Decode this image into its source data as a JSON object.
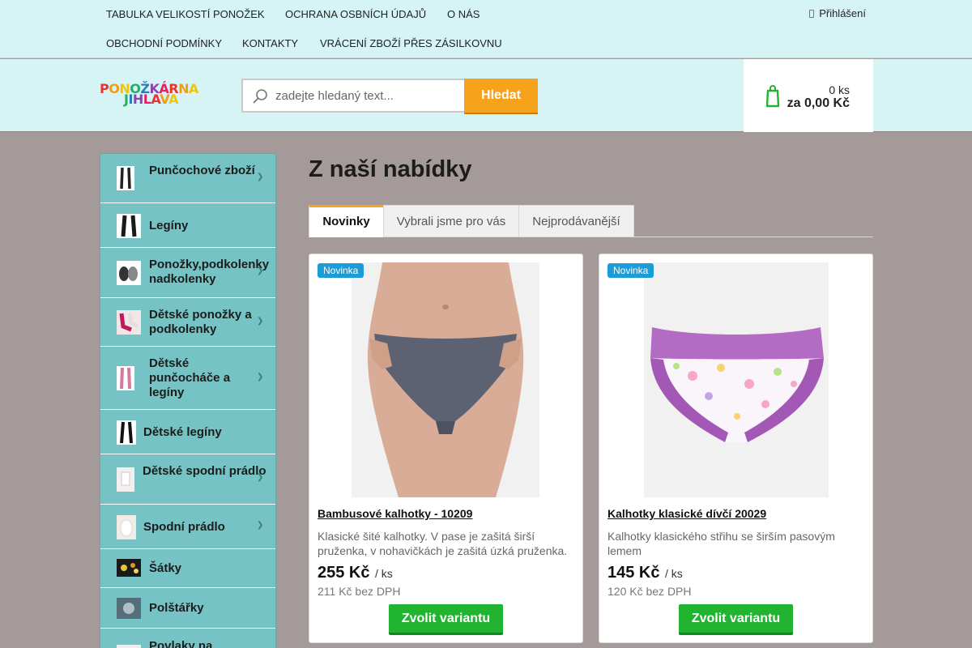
{
  "topnav": {
    "links": [
      "TABULKA VELIKOSTÍ PONOŽEK",
      "OCHRANA OSBNÍCH ÚDAJŮ",
      "O NÁS",
      "OBCHODNÍ PODMÍNKY",
      "KONTAKTY",
      "VRÁCENÍ ZBOŽÍ PŘES ZÁSILKOVNU"
    ],
    "login_label": "Přihlášení",
    "login_icon": "user-icon"
  },
  "header": {
    "logo_line1": "PONOŽKÁRNA",
    "logo_line2": "JIHLAVA",
    "logo_colors": [
      "#e4352f",
      "#f39c12",
      "#f1c40f",
      "#27ae60",
      "#2980b9",
      "#8e44ad",
      "#e91e63"
    ],
    "search": {
      "placeholder": "zadejte hledaný text...",
      "button": "Hledat",
      "icon": "search-icon"
    },
    "cart": {
      "qty": "0 ks",
      "total": "za 0,00 Kč",
      "icon": "shopping-bag-icon"
    }
  },
  "sidebar": {
    "items": [
      {
        "label": "Punčochové zboží",
        "has_sub": true
      },
      {
        "label": "Legíny",
        "has_sub": false
      },
      {
        "label": "Ponožky,podkolenky nadkolenky",
        "has_sub": true
      },
      {
        "label": "Dětské ponožky a podkolenky",
        "has_sub": true
      },
      {
        "label": "Dětské punčocháče a legíny",
        "has_sub": true
      },
      {
        "label": "Dětské legíny",
        "has_sub": false
      },
      {
        "label": "Dětské spodní prádlo",
        "has_sub": true
      },
      {
        "label": "Spodní prádlo",
        "has_sub": true
      },
      {
        "label": "Šátky",
        "has_sub": false
      },
      {
        "label": "Polštářky",
        "has_sub": false
      },
      {
        "label": "Povlaky na",
        "has_sub": false
      }
    ]
  },
  "main": {
    "title": "Z naší nabídky",
    "tabs": [
      {
        "label": "Novinky",
        "active": true
      },
      {
        "label": "Vybrali jsme pro vás",
        "active": false
      },
      {
        "label": "Nejprodávanější",
        "active": false
      }
    ],
    "products": [
      {
        "badge": "Novinka",
        "name": "Bambusové kalhotky - 10209",
        "description": "Klasické šité kalhotky. V pase je zašitá širší pruženka, v nohavičkách je zašitá úzká pruženka.",
        "price": "255 Kč",
        "unit": "/ ks",
        "price_no_vat": "211 Kč bez DPH",
        "button": "Zvolit variantu"
      },
      {
        "badge": "Novinka",
        "name": "Kalhotky klasické dívčí 20029",
        "description": "Kalhotky klasického střihu se širším pasovým lemem",
        "price": "145 Kč",
        "unit": "/ ks",
        "price_no_vat": "120 Kč bez DPH",
        "button": "Zvolit variantu"
      }
    ]
  },
  "colors": {
    "accent_orange": "#f7a21b",
    "header_bg": "#d6f3f6",
    "sidebar_bg": "#75c3c4",
    "page_bg": "#a39a99",
    "badge_blue": "#1b9bd7",
    "button_green": "#20b431"
  }
}
